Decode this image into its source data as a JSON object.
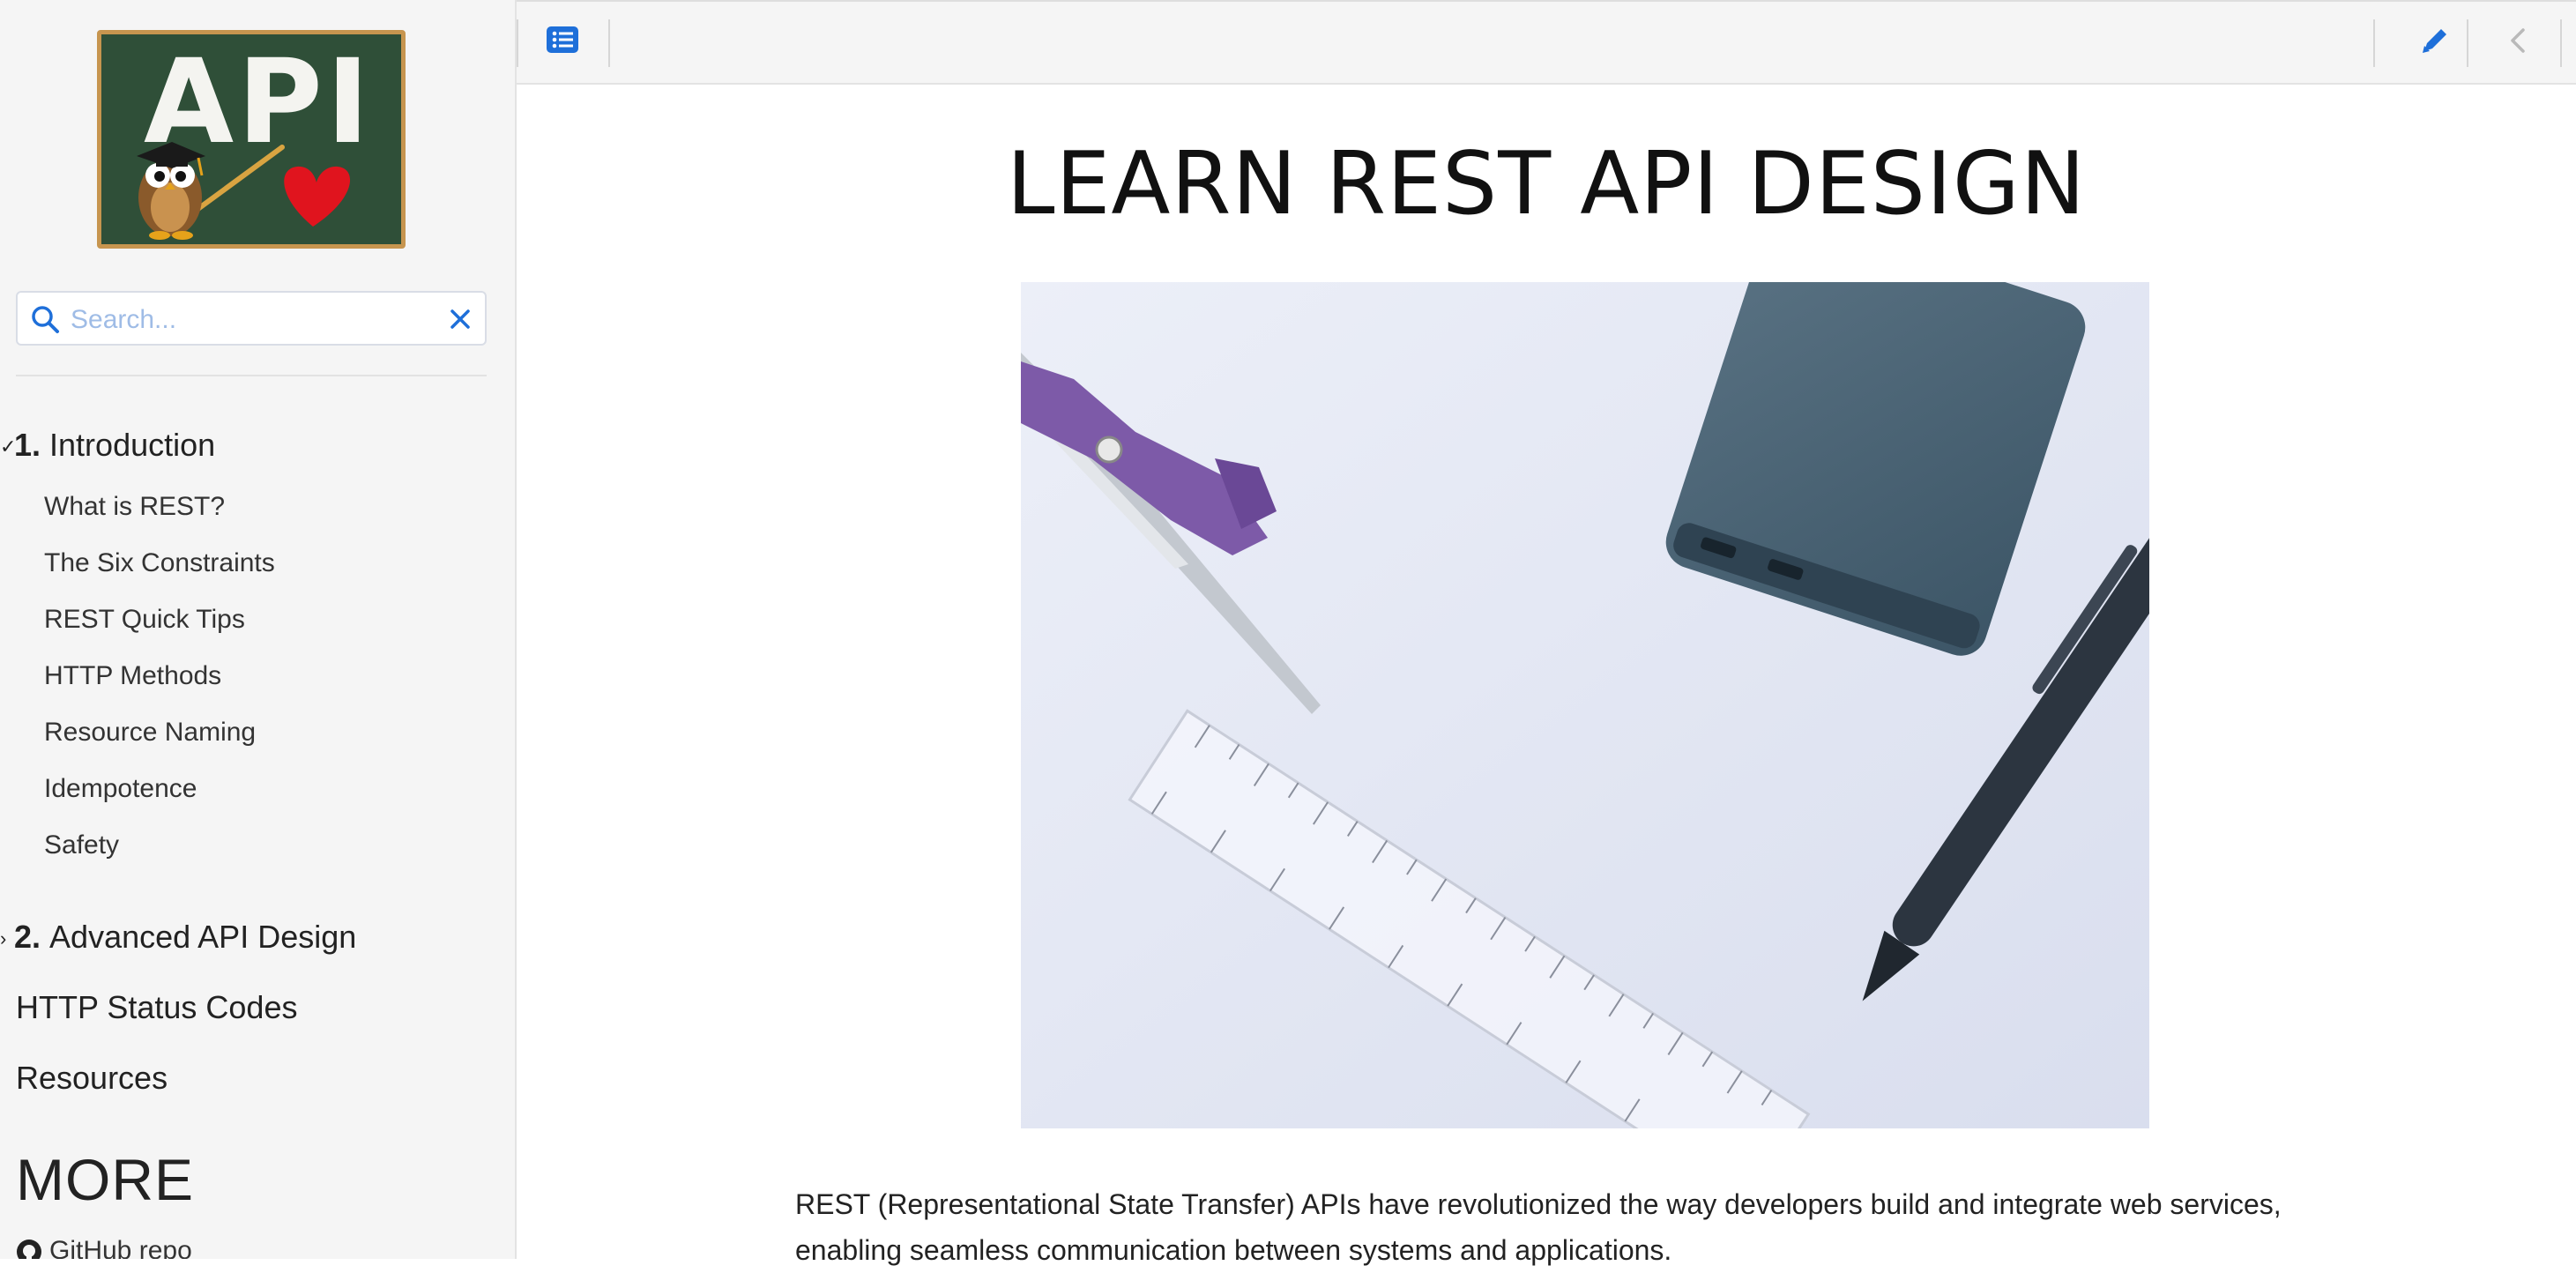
{
  "sidebar": {
    "logo_text": "API",
    "search": {
      "placeholder": "Search...",
      "value": ""
    },
    "sections": [
      {
        "number": "1.",
        "title": "Introduction",
        "expanded": true,
        "items": [
          "What is REST?",
          "The Six Constraints",
          "REST Quick Tips",
          "HTTP Methods",
          "Resource Naming",
          "Idempotence",
          "Safety"
        ]
      },
      {
        "number": "2.",
        "title": "Advanced API Design",
        "expanded": false,
        "items": []
      }
    ],
    "top_links": [
      "HTTP Status Codes",
      "Resources"
    ],
    "more_heading": "MORE",
    "more_links": [
      "GitHub repo"
    ]
  },
  "topbar": {
    "toc_icon": "list-icon",
    "edit_icon": "pencil-icon",
    "prev_icon": "chevron-left-icon"
  },
  "main": {
    "title": "LEARN REST API DESIGN",
    "intro": "REST (Representational State Transfer) APIs have revolutionized the way developers build and integrate web services, enabling seamless communication between systems and applications."
  },
  "colors": {
    "accent": "#1e6fd9",
    "sidebar_bg": "#f5f5f5",
    "chalkboard": "#2f4f38",
    "frame": "#c7954f",
    "search_placeholder": "#9fbce6"
  }
}
